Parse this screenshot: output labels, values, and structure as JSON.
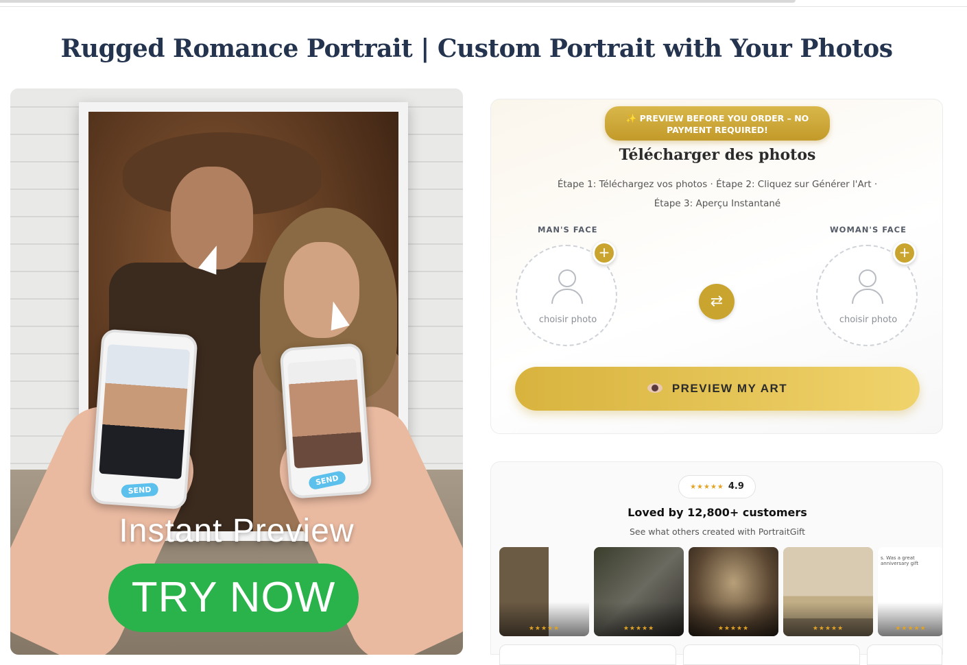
{
  "page": {
    "title": "Rugged Romance Portrait | Custom Portrait with Your Photos"
  },
  "hero": {
    "send_label_left": "SEND",
    "send_label_right": "SEND",
    "instant_preview": "Instant Preview",
    "try_now": "TRY NOW"
  },
  "upload": {
    "badge": "✨ PREVIEW BEFORE YOU ORDER – NO PAYMENT REQUIRED!",
    "title": "Télécharger des photos",
    "steps_line1": "Étape 1: Téléchargez vos photos · Étape 2: Cliquez sur Générer l'Art ·",
    "steps_line2": "Étape 3: Aperçu Instantané",
    "man_label": "MAN'S FACE",
    "woman_label": "WOMAN'S FACE",
    "man_pick": "choisir photo",
    "woman_pick": "choisir photo",
    "plus_symbol": "+",
    "swap_symbol": "⇄",
    "preview_button": "PREVIEW MY ART"
  },
  "reviews": {
    "stars": "★★★★★",
    "rating": "4.9",
    "headline": "Loved by 12,800+ customers",
    "subline": "See what others created with PortraitGift",
    "thumbnails": [
      {
        "stars": "★★★★★",
        "caption": ""
      },
      {
        "stars": "★★★★★",
        "caption": ""
      },
      {
        "stars": "★★★★★",
        "caption": ""
      },
      {
        "stars": "★★★★★",
        "caption": ""
      },
      {
        "stars": "★★★★★",
        "caption": "s. Was a great anniversary gift"
      }
    ]
  },
  "colors": {
    "gold": "#c9a52f",
    "try_now_green": "#2ab24b",
    "title_navy": "#24344f"
  }
}
